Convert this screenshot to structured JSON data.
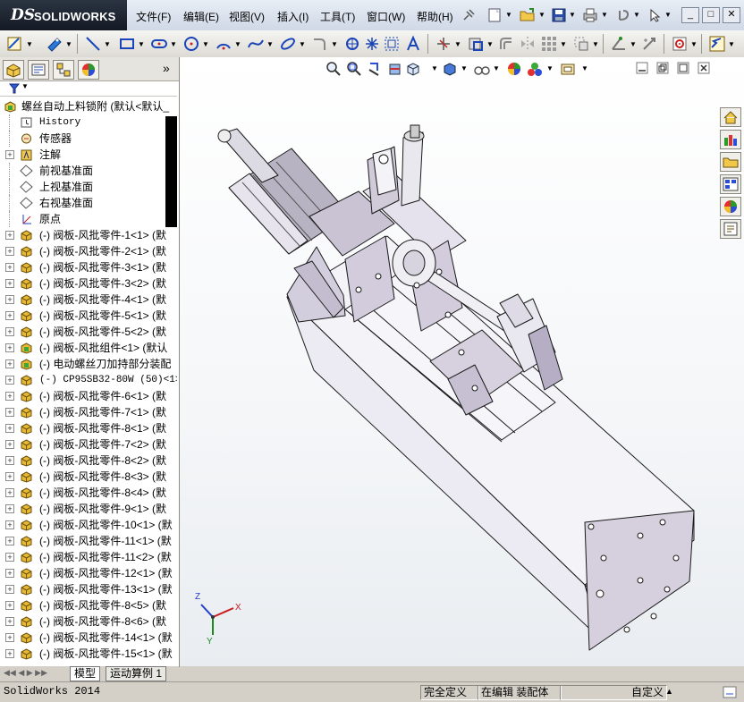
{
  "app": {
    "logo_ds": "DS",
    "logo_brand": "SOLIDWORKS",
    "menu": [
      "文件(F)",
      "编辑(E)",
      "视图(V)",
      "插入(I)",
      "工具(T)",
      "窗口(W)",
      "帮助(H)"
    ],
    "window_buttons": [
      "_",
      "□",
      "✕"
    ]
  },
  "panel": {
    "tabs": [
      "feature-manager",
      "property-manager",
      "configuration-manager",
      "display-manager"
    ],
    "expand_label": "»",
    "root": "螺丝自动上料锁附  (默认<默认_",
    "items": [
      {
        "label": "History",
        "mono": true,
        "expand": false,
        "icon": "history"
      },
      {
        "label": "传感器",
        "expand": false,
        "icon": "sensor"
      },
      {
        "label": "注解",
        "expand": true,
        "icon": "annotation"
      },
      {
        "label": "前视基准面",
        "expand": false,
        "icon": "plane"
      },
      {
        "label": "上视基准面",
        "expand": false,
        "icon": "plane"
      },
      {
        "label": "右视基准面",
        "expand": false,
        "icon": "plane"
      },
      {
        "label": "原点",
        "expand": false,
        "icon": "origin"
      },
      {
        "label": "(-) 阀板-风批零件-1<1> (默",
        "expand": true,
        "icon": "part"
      },
      {
        "label": "(-) 阀板-风批零件-2<1> (默",
        "expand": true,
        "icon": "part"
      },
      {
        "label": "(-) 阀板-风批零件-3<1> (默",
        "expand": true,
        "icon": "part"
      },
      {
        "label": "(-) 阀板-风批零件-3<2> (默",
        "expand": true,
        "icon": "part"
      },
      {
        "label": "(-) 阀板-风批零件-4<1> (默",
        "expand": true,
        "icon": "part"
      },
      {
        "label": "(-) 阀板-风批零件-5<1> (默",
        "expand": true,
        "icon": "part"
      },
      {
        "label": "(-) 阀板-风批零件-5<2> (默",
        "expand": true,
        "icon": "part"
      },
      {
        "label": "(-) 阀板-风批组件<1> (默认",
        "expand": true,
        "icon": "assembly"
      },
      {
        "label": "(-) 电动螺丝刀加持部分装配",
        "expand": true,
        "icon": "assembly"
      },
      {
        "label": "(-) CP95SB32-80W (50)<1>",
        "expand": true,
        "icon": "part",
        "mono": true
      },
      {
        "label": "(-) 阀板-风批零件-6<1> (默",
        "expand": true,
        "icon": "part"
      },
      {
        "label": "(-) 阀板-风批零件-7<1> (默",
        "expand": true,
        "icon": "part"
      },
      {
        "label": "(-) 阀板-风批零件-8<1> (默",
        "expand": true,
        "icon": "part"
      },
      {
        "label": "(-) 阀板-风批零件-7<2> (默",
        "expand": true,
        "icon": "part"
      },
      {
        "label": "(-) 阀板-风批零件-8<2> (默",
        "expand": true,
        "icon": "part"
      },
      {
        "label": "(-) 阀板-风批零件-8<3> (默",
        "expand": true,
        "icon": "part"
      },
      {
        "label": "(-) 阀板-风批零件-8<4> (默",
        "expand": true,
        "icon": "part"
      },
      {
        "label": "(-) 阀板-风批零件-9<1> (默",
        "expand": true,
        "icon": "part"
      },
      {
        "label": "(-) 阀板-风批零件-10<1> (默",
        "expand": true,
        "icon": "part"
      },
      {
        "label": "(-) 阀板-风批零件-11<1> (默",
        "expand": true,
        "icon": "part"
      },
      {
        "label": "(-) 阀板-风批零件-11<2> (默",
        "expand": true,
        "icon": "part"
      },
      {
        "label": "(-) 阀板-风批零件-12<1> (默",
        "expand": true,
        "icon": "part"
      },
      {
        "label": "(-) 阀板-风批零件-13<1> (默",
        "expand": true,
        "icon": "part"
      },
      {
        "label": "(-) 阀板-风批零件-8<5> (默",
        "expand": true,
        "icon": "part"
      },
      {
        "label": "(-) 阀板-风批零件-8<6> (默",
        "expand": true,
        "icon": "part"
      },
      {
        "label": "(-) 阀板-风批零件-14<1> (默",
        "expand": true,
        "icon": "part"
      },
      {
        "label": "(-) 阀板-风批零件-15<1> (默",
        "expand": true,
        "icon": "part"
      }
    ],
    "bottom_tabs": [
      "模型",
      "运动算例 1"
    ]
  },
  "triad": {
    "x": "X",
    "y": "Y",
    "z": "Z"
  },
  "status": {
    "app_version": "SolidWorks 2014",
    "definition": "完全定义",
    "editing": "在编辑 装配体",
    "custom": "自定义"
  },
  "colors": {
    "part_icon": "#e8b830",
    "model_face": "#f3f2f6",
    "model_line": "#222222",
    "accent": "#c8c8dc"
  }
}
